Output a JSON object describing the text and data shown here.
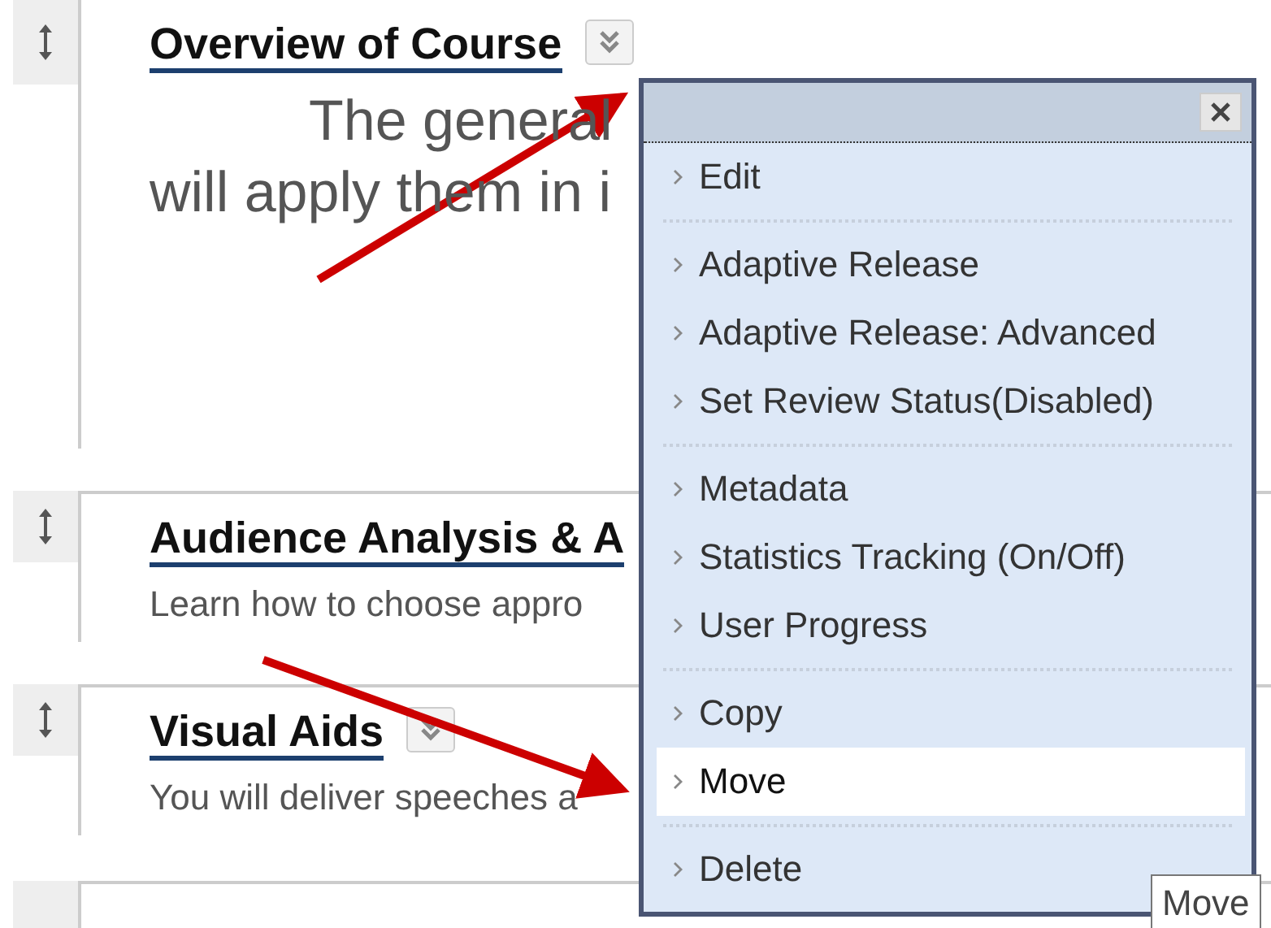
{
  "content_items": [
    {
      "kind": "large",
      "title": "Overview of Course",
      "menu_button": true,
      "lines": [
        {
          "text": "The general",
          "indent": true
        },
        {
          "text": "will apply them in i",
          "indent": false
        }
      ]
    },
    {
      "kind": "small",
      "title": "Audience Analysis & A",
      "menu_button": false,
      "lines": [
        {
          "text": "Learn how to choose appro",
          "indent": false
        }
      ]
    },
    {
      "kind": "small",
      "title": "Visual Aids",
      "menu_button": true,
      "lines": [
        {
          "text": "You will deliver speeches a",
          "indent": false
        }
      ]
    }
  ],
  "context_menu": {
    "groups": [
      [
        {
          "label": "Edit",
          "selected": false
        }
      ],
      [
        {
          "label": "Adaptive Release",
          "selected": false
        },
        {
          "label": "Adaptive Release: Advanced",
          "selected": false
        },
        {
          "label": "Set Review Status(Disabled)",
          "selected": false
        }
      ],
      [
        {
          "label": "Metadata",
          "selected": false
        },
        {
          "label": "Statistics Tracking (On/Off)",
          "selected": false
        },
        {
          "label": "User Progress",
          "selected": false
        }
      ],
      [
        {
          "label": "Copy",
          "selected": false
        },
        {
          "label": "Move",
          "selected": true
        }
      ],
      [
        {
          "label": "Delete",
          "selected": false
        }
      ]
    ]
  },
  "tooltip": "Move"
}
